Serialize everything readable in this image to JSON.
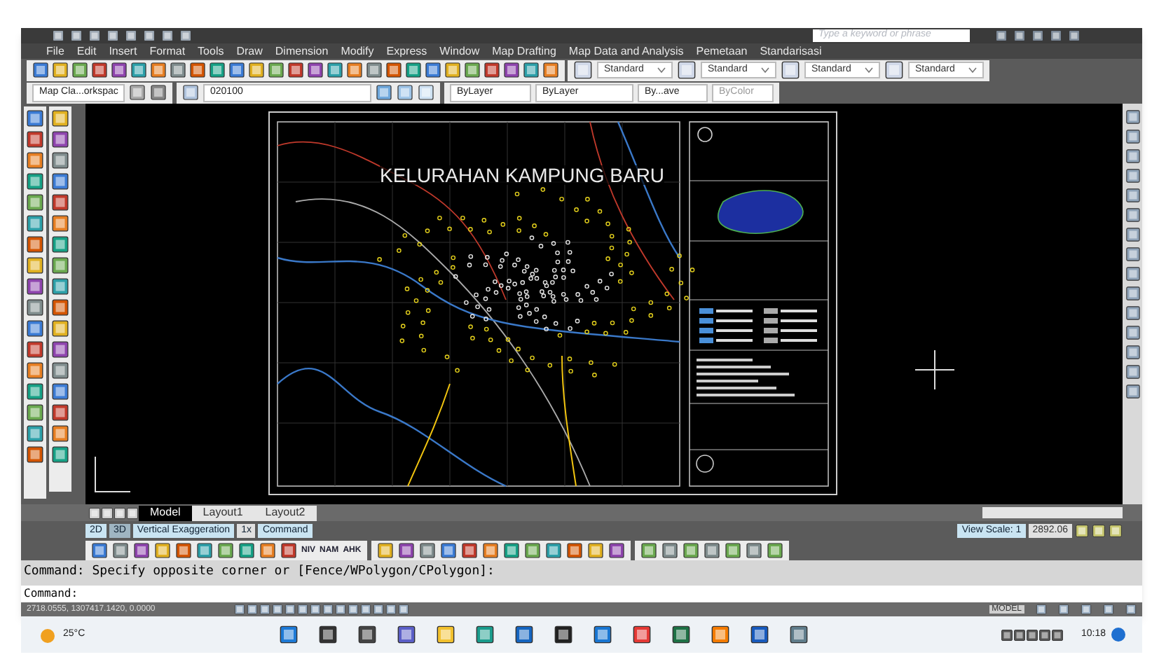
{
  "menu": [
    "File",
    "Edit",
    "Insert",
    "Format",
    "Tools",
    "Draw",
    "Dimension",
    "Modify",
    "Express",
    "Window",
    "Map Drafting",
    "Map Data and Analysis",
    "Pemetaan",
    "Standarisasi"
  ],
  "search": {
    "placeholder": "Type a keyword or phrase"
  },
  "styles": [
    "Standard",
    "Standard",
    "Standard",
    "Standard"
  ],
  "properties": {
    "workspace": "Map Cla...orkspac",
    "layer": "020100",
    "layer_color": "ByLayer",
    "linetype": "ByLayer",
    "lineweight": "By...ave",
    "plotstyle": "ByColor"
  },
  "drawing": {
    "title": "KELURAHAN KAMPUNG BARU"
  },
  "layout_tabs": [
    {
      "label": "Model",
      "selected": true
    },
    {
      "label": "Layout1",
      "selected": false
    },
    {
      "label": "Layout2",
      "selected": false
    }
  ],
  "map_bar": {
    "mode_2d": "2D",
    "mode_3d": "3D",
    "exaggeration": "Vertical Exaggeration",
    "factor": "1x",
    "command": "Command"
  },
  "text_tools": [
    "NIV",
    "NAM",
    "AHK"
  ],
  "view_scale": {
    "label": "View Scale: 1",
    "value": "2892.06"
  },
  "command_history": "Command: Specify opposite corner or [Fence/WPolygon/CPolygon]:",
  "command_prompt": "Command:",
  "coordinates": "2718.0555, 1307417.1420, 0.0000",
  "space": "MODEL",
  "taskbar": {
    "temperature": "25°C",
    "time": "10:18"
  }
}
